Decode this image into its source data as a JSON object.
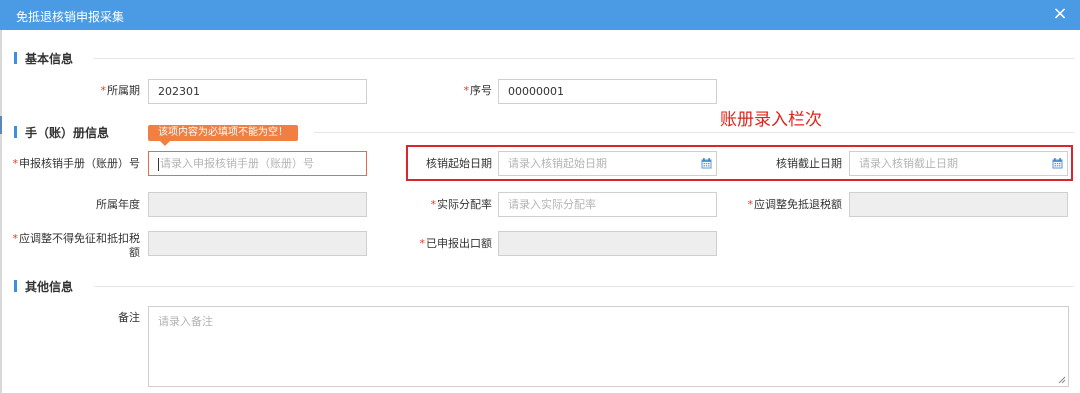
{
  "dialog": {
    "title": "免抵退核销申报采集",
    "close_glyph": "×"
  },
  "sections": {
    "basic": "基本信息",
    "ledger": "手（账）册信息",
    "other": "其他信息"
  },
  "required_mark": "*",
  "fields": {
    "period": {
      "label": "所属期",
      "value": "202301",
      "required": true
    },
    "seq": {
      "label": "序号",
      "value": "00000001",
      "required": true
    },
    "manual_no": {
      "label": "申报核销手册（账册）号",
      "placeholder": "请录入申报核销手册（账册）号",
      "required": true
    },
    "start_date": {
      "label": "核销起始日期",
      "placeholder": "请录入核销起始日期",
      "required": false
    },
    "end_date": {
      "label": "核销截止日期",
      "placeholder": "请录入核销截止日期",
      "required": false
    },
    "year": {
      "label": "所属年度",
      "value": "",
      "required": false
    },
    "alloc_rate": {
      "label": "实际分配率",
      "placeholder": "请录入实际分配率",
      "required": true
    },
    "adj_refund": {
      "label": "应调整免抵退税额",
      "value": "",
      "required": true
    },
    "adj_nondeduct_line1": {
      "label": "应调整不得免征和抵扣税",
      "required": true
    },
    "adj_nondeduct_line2": {
      "label": "额"
    },
    "declared_export": {
      "label": "已申报出口额",
      "value": "",
      "required": true
    },
    "remark": {
      "label": "备注",
      "placeholder": "请录入备注"
    }
  },
  "tooltip": "该项内容为必填项不能为空！",
  "annotation": "账册录入栏次",
  "colors": {
    "titlebar": "#4a9be4",
    "section_bar": "#3d8fe0",
    "required": "#e23b2a",
    "tooltip": "#f17f42",
    "error_border": "#ec6a4b",
    "annotation": "#e2231a",
    "disabled_bg": "#eeeeee"
  },
  "icons": {
    "close": "close-icon",
    "calendar": "calendar-icon",
    "resize": "resize-grip-icon"
  }
}
